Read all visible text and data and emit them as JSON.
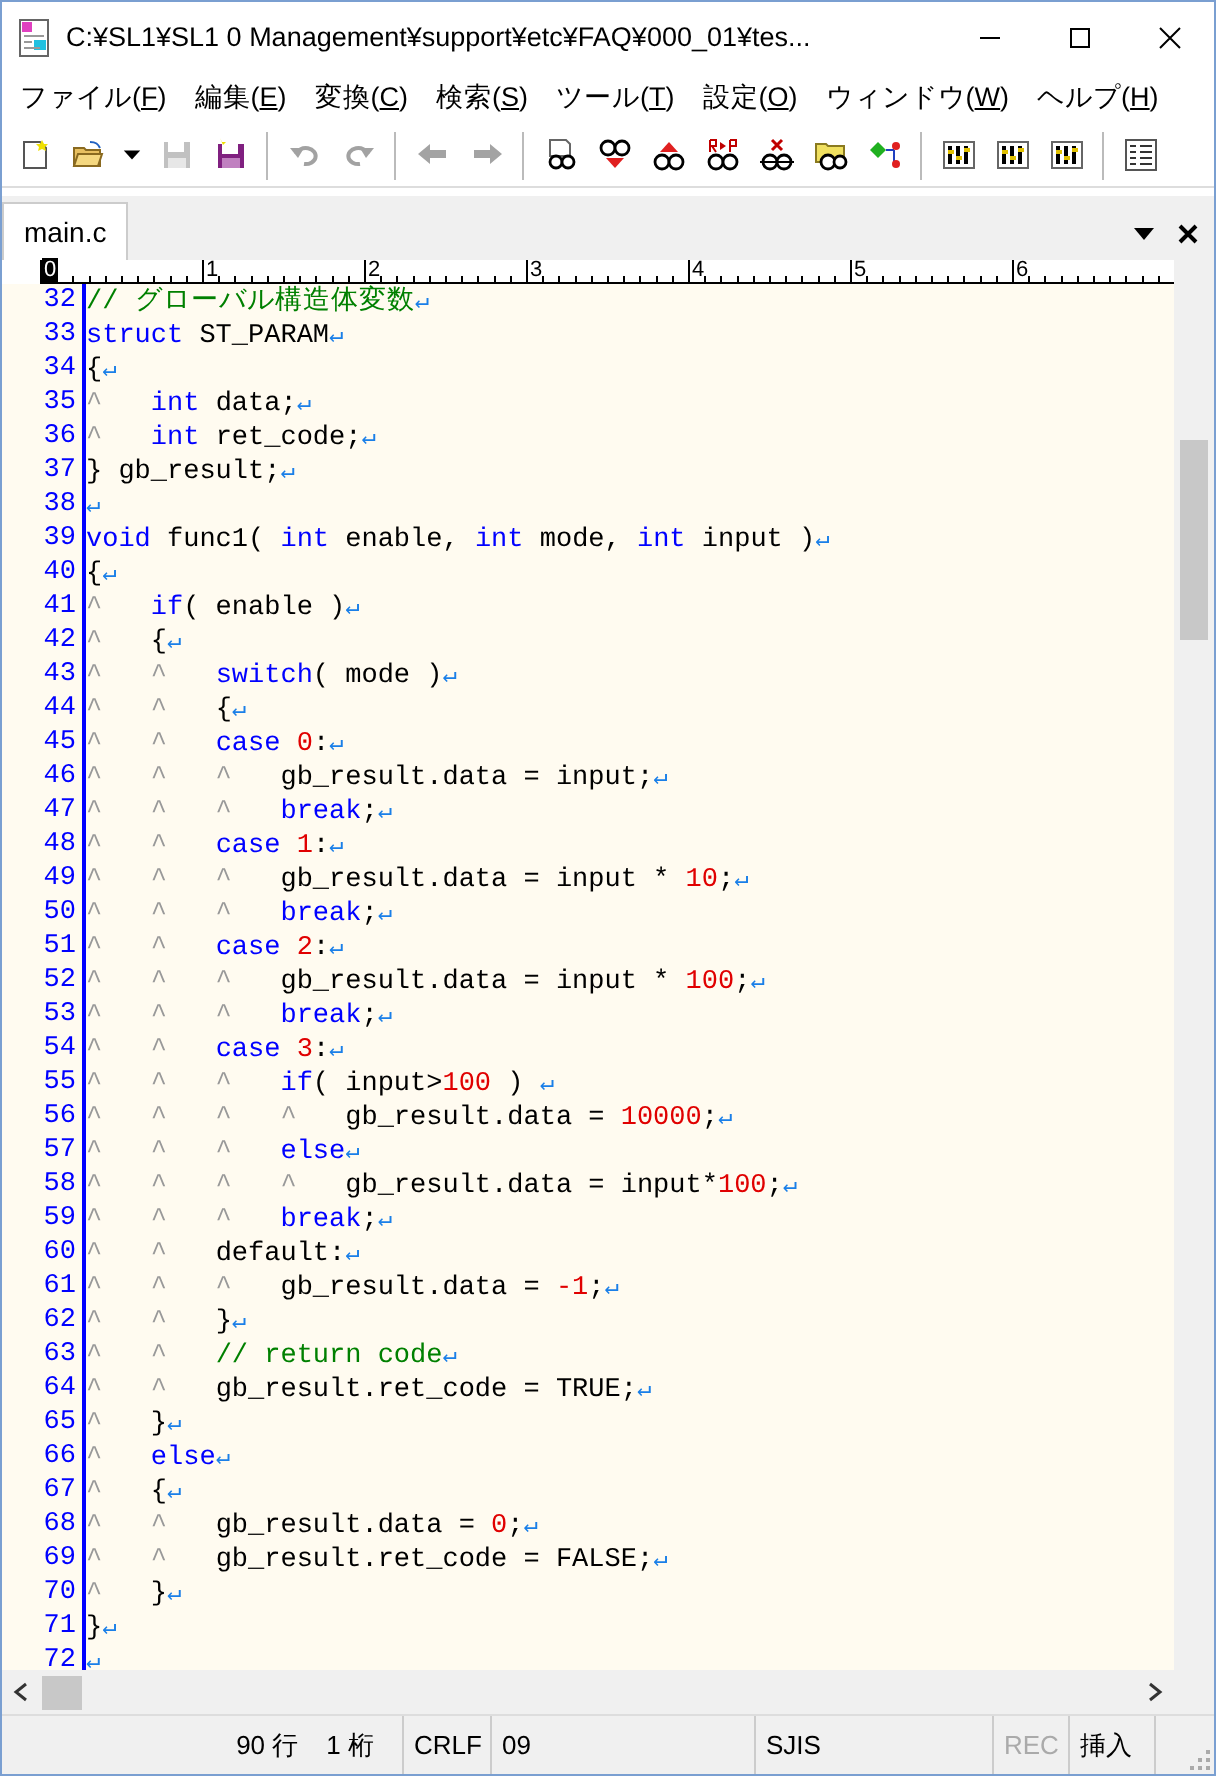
{
  "window": {
    "title": "C:¥SL1¥SL1 0 Management¥support¥etc¥FAQ¥000_01¥tes..."
  },
  "menu": [
    {
      "label": "ファイル(F)"
    },
    {
      "label": "編集(E)"
    },
    {
      "label": "変換(C)"
    },
    {
      "label": "検索(S)"
    },
    {
      "label": "ツール(T)"
    },
    {
      "label": "設定(O)"
    },
    {
      "label": "ウィンドウ(W)"
    },
    {
      "label": "ヘルプ(H)"
    }
  ],
  "toolbar": [
    {
      "kind": "new",
      "disabled": false
    },
    {
      "kind": "open",
      "disabled": false
    },
    {
      "kind": "caret",
      "disabled": false
    },
    {
      "kind": "save",
      "disabled": true
    },
    {
      "kind": "save-as",
      "disabled": false
    },
    {
      "kind": "separator"
    },
    {
      "kind": "undo",
      "disabled": true
    },
    {
      "kind": "redo",
      "disabled": true
    },
    {
      "kind": "separator"
    },
    {
      "kind": "back",
      "disabled": true
    },
    {
      "kind": "forward",
      "disabled": true
    },
    {
      "kind": "separator"
    },
    {
      "kind": "search",
      "disabled": false
    },
    {
      "kind": "find-next",
      "disabled": false
    },
    {
      "kind": "find-prev",
      "disabled": false
    },
    {
      "kind": "replace",
      "disabled": false
    },
    {
      "kind": "clear",
      "disabled": false
    },
    {
      "kind": "grep",
      "disabled": false
    },
    {
      "kind": "diagram",
      "disabled": false
    },
    {
      "kind": "separator"
    },
    {
      "kind": "tool",
      "disabled": false
    },
    {
      "kind": "tool",
      "disabled": false
    },
    {
      "kind": "tool",
      "disabled": false
    },
    {
      "kind": "separator"
    },
    {
      "kind": "list",
      "disabled": false
    }
  ],
  "tabs": [
    {
      "label": "main.c",
      "selected": true
    }
  ],
  "ruler": [
    {
      "label": "0",
      "current": true
    },
    {
      "label": "1",
      "current": false
    },
    {
      "label": "2",
      "current": false
    },
    {
      "label": "3",
      "current": false
    },
    {
      "label": "4",
      "current": false
    },
    {
      "label": "5",
      "current": false
    },
    {
      "label": "6",
      "current": false
    }
  ],
  "editor": {
    "eol_mark": "↵",
    "lines": [
      {
        "number": "32",
        "tokens": [
          {
            "kind": "comment",
            "text": "// グローバル構造体変数"
          }
        ]
      },
      {
        "number": "33",
        "tokens": [
          {
            "kind": "keyword",
            "text": "struct"
          },
          {
            "kind": "plain",
            "text": " ST_PARAM"
          }
        ]
      },
      {
        "number": "34",
        "tokens": [
          {
            "kind": "plain",
            "text": "{"
          }
        ]
      },
      {
        "number": "35",
        "tab_marks": "^   ",
        "tokens": [
          {
            "kind": "keyword",
            "text": "int"
          },
          {
            "kind": "plain",
            "text": " data;"
          }
        ]
      },
      {
        "number": "36",
        "tab_marks": "^   ",
        "tokens": [
          {
            "kind": "keyword",
            "text": "int"
          },
          {
            "kind": "plain",
            "text": " ret_code;"
          }
        ]
      },
      {
        "number": "37",
        "tokens": [
          {
            "kind": "plain",
            "text": "} gb_result;"
          }
        ]
      },
      {
        "number": "38"
      },
      {
        "number": "39",
        "tokens": [
          {
            "kind": "keyword",
            "text": "void"
          },
          {
            "kind": "plain",
            "text": " func1( "
          },
          {
            "kind": "keyword",
            "text": "int"
          },
          {
            "kind": "plain",
            "text": " enable, "
          },
          {
            "kind": "keyword",
            "text": "int"
          },
          {
            "kind": "plain",
            "text": " mode, "
          },
          {
            "kind": "keyword",
            "text": "int"
          },
          {
            "kind": "plain",
            "text": " input )"
          }
        ]
      },
      {
        "number": "40",
        "tokens": [
          {
            "kind": "plain",
            "text": "{"
          }
        ]
      },
      {
        "number": "41",
        "tab_marks": "^   ",
        "tokens": [
          {
            "kind": "keyword",
            "text": "if"
          },
          {
            "kind": "plain",
            "text": "( enable )"
          }
        ]
      },
      {
        "number": "42",
        "tab_marks": "^   ",
        "tokens": [
          {
            "kind": "plain",
            "text": "{"
          }
        ]
      },
      {
        "number": "43",
        "tab_marks": "^   ^   ",
        "tokens": [
          {
            "kind": "keyword",
            "text": "switch"
          },
          {
            "kind": "plain",
            "text": "( mode )"
          }
        ]
      },
      {
        "number": "44",
        "tab_marks": "^   ^   ",
        "tokens": [
          {
            "kind": "plain",
            "text": "{"
          }
        ]
      },
      {
        "number": "45",
        "tab_marks": "^   ^   ",
        "tokens": [
          {
            "kind": "keyword",
            "text": "case "
          },
          {
            "kind": "number",
            "text": "0"
          },
          {
            "kind": "plain",
            "text": ":"
          }
        ]
      },
      {
        "number": "46",
        "tab_marks": "^   ^   ^   ",
        "tokens": [
          {
            "kind": "plain",
            "text": "gb_result.data = input;"
          }
        ]
      },
      {
        "number": "47",
        "tab_marks": "^   ^   ^   ",
        "tokens": [
          {
            "kind": "keyword",
            "text": "break"
          },
          {
            "kind": "plain",
            "text": ";"
          }
        ]
      },
      {
        "number": "48",
        "tab_marks": "^   ^   ",
        "tokens": [
          {
            "kind": "keyword",
            "text": "case "
          },
          {
            "kind": "number",
            "text": "1"
          },
          {
            "kind": "plain",
            "text": ":"
          }
        ]
      },
      {
        "number": "49",
        "tab_marks": "^   ^   ^   ",
        "tokens": [
          {
            "kind": "plain",
            "text": "gb_result.data = input * "
          },
          {
            "kind": "number",
            "text": "10"
          },
          {
            "kind": "plain",
            "text": ";"
          }
        ]
      },
      {
        "number": "50",
        "tab_marks": "^   ^   ^   ",
        "tokens": [
          {
            "kind": "keyword",
            "text": "break"
          },
          {
            "kind": "plain",
            "text": ";"
          }
        ]
      },
      {
        "number": "51",
        "tab_marks": "^   ^   ",
        "tokens": [
          {
            "kind": "keyword",
            "text": "case "
          },
          {
            "kind": "number",
            "text": "2"
          },
          {
            "kind": "plain",
            "text": ":"
          }
        ]
      },
      {
        "number": "52",
        "tab_marks": "^   ^   ^   ",
        "tokens": [
          {
            "kind": "plain",
            "text": "gb_result.data = input * "
          },
          {
            "kind": "number",
            "text": "100"
          },
          {
            "kind": "plain",
            "text": ";"
          }
        ]
      },
      {
        "number": "53",
        "tab_marks": "^   ^   ^   ",
        "tokens": [
          {
            "kind": "keyword",
            "text": "break"
          },
          {
            "kind": "plain",
            "text": ";"
          }
        ]
      },
      {
        "number": "54",
        "tab_marks": "^   ^   ",
        "tokens": [
          {
            "kind": "keyword",
            "text": "case "
          },
          {
            "kind": "number",
            "text": "3"
          },
          {
            "kind": "plain",
            "text": ":"
          }
        ]
      },
      {
        "number": "55",
        "tab_marks": "^   ^   ^   ",
        "tokens": [
          {
            "kind": "keyword",
            "text": "if"
          },
          {
            "kind": "plain",
            "text": "( input>"
          },
          {
            "kind": "number",
            "text": "100"
          },
          {
            "kind": "plain",
            "text": " ) "
          }
        ]
      },
      {
        "number": "56",
        "tab_marks": "^   ^   ^   ^   ",
        "tokens": [
          {
            "kind": "plain",
            "text": "gb_result.data = "
          },
          {
            "kind": "number",
            "text": "10000"
          },
          {
            "kind": "plain",
            "text": ";"
          }
        ]
      },
      {
        "number": "57",
        "tab_marks": "^   ^   ^   ",
        "tokens": [
          {
            "kind": "keyword",
            "text": "else"
          }
        ]
      },
      {
        "number": "58",
        "tab_marks": "^   ^   ^   ^   ",
        "tokens": [
          {
            "kind": "plain",
            "text": "gb_result.data = input*"
          },
          {
            "kind": "number",
            "text": "100"
          },
          {
            "kind": "plain",
            "text": ";"
          }
        ]
      },
      {
        "number": "59",
        "tab_marks": "^   ^   ^   ",
        "tokens": [
          {
            "kind": "keyword",
            "text": "break"
          },
          {
            "kind": "plain",
            "text": ";"
          }
        ]
      },
      {
        "number": "60",
        "tab_marks": "^   ^   ",
        "tokens": [
          {
            "kind": "plain",
            "text": "default:"
          }
        ]
      },
      {
        "number": "61",
        "tab_marks": "^   ^   ^   ",
        "tokens": [
          {
            "kind": "plain",
            "text": "gb_result.data = "
          },
          {
            "kind": "number",
            "text": "-1"
          },
          {
            "kind": "plain",
            "text": ";"
          }
        ]
      },
      {
        "number": "62",
        "tab_marks": "^   ^   ",
        "tokens": [
          {
            "kind": "plain",
            "text": "}"
          }
        ]
      },
      {
        "number": "63",
        "tab_marks": "^   ^   ",
        "tokens": [
          {
            "kind": "comment",
            "text": "// return code"
          }
        ]
      },
      {
        "number": "64",
        "tab_marks": "^   ^   ",
        "tokens": [
          {
            "kind": "plain",
            "text": "gb_result.ret_code = TRUE;"
          }
        ]
      },
      {
        "number": "65",
        "tab_marks": "^   ",
        "tokens": [
          {
            "kind": "plain",
            "text": "}"
          }
        ]
      },
      {
        "number": "66",
        "tab_marks": "^   ",
        "tokens": [
          {
            "kind": "keyword",
            "text": "else"
          }
        ]
      },
      {
        "number": "67",
        "tab_marks": "^   ",
        "tokens": [
          {
            "kind": "plain",
            "text": "{"
          }
        ]
      },
      {
        "number": "68",
        "tab_marks": "^   ^   ",
        "tokens": [
          {
            "kind": "plain",
            "text": "gb_result.data = "
          },
          {
            "kind": "number",
            "text": "0"
          },
          {
            "kind": "plain",
            "text": ";"
          }
        ]
      },
      {
        "number": "69",
        "tab_marks": "^   ^   ",
        "tokens": [
          {
            "kind": "plain",
            "text": "gb_result.ret_code = FALSE;"
          }
        ]
      },
      {
        "number": "70",
        "tab_marks": "^   ",
        "tokens": [
          {
            "kind": "plain",
            "text": "}"
          }
        ]
      },
      {
        "number": "71",
        "tokens": [
          {
            "kind": "plain",
            "text": "}"
          }
        ]
      },
      {
        "number": "72"
      }
    ]
  },
  "status_bar": {
    "line": "90 行",
    "column": "1 桁",
    "line_ending": "CRLF",
    "field_4": "09",
    "encoding": "SJIS",
    "recording": {
      "text": "REC",
      "disabled": true
    },
    "input_mode": "挿入"
  }
}
